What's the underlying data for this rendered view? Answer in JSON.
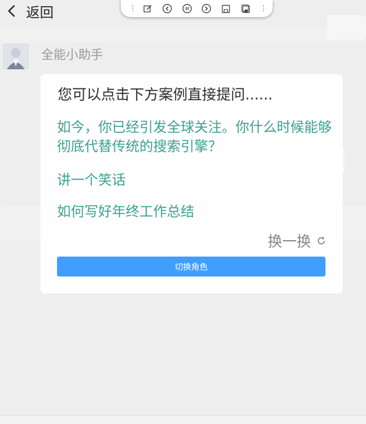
{
  "header": {
    "back_label": "返回"
  },
  "toolbar": {
    "buttons": [
      "more-icon",
      "edit-icon",
      "prev-icon",
      "pause-icon",
      "next-icon",
      "save-icon",
      "save-all-icon",
      "more-icon"
    ]
  },
  "assistant": {
    "name": "全能小助手"
  },
  "prompt_card": {
    "title": "您可以点击下方案例直接提问......",
    "questions": [
      "如今，你已经引发全球关注。你什么时候能够彻底代替传统的搜索引擎？",
      "讲一个笑话",
      "如何写好年终工作总结"
    ],
    "refresh_label": "换一换",
    "switch_role_label": "切换角色"
  },
  "colors": {
    "accent_green": "#3aa18e",
    "button_blue": "#409eff"
  }
}
